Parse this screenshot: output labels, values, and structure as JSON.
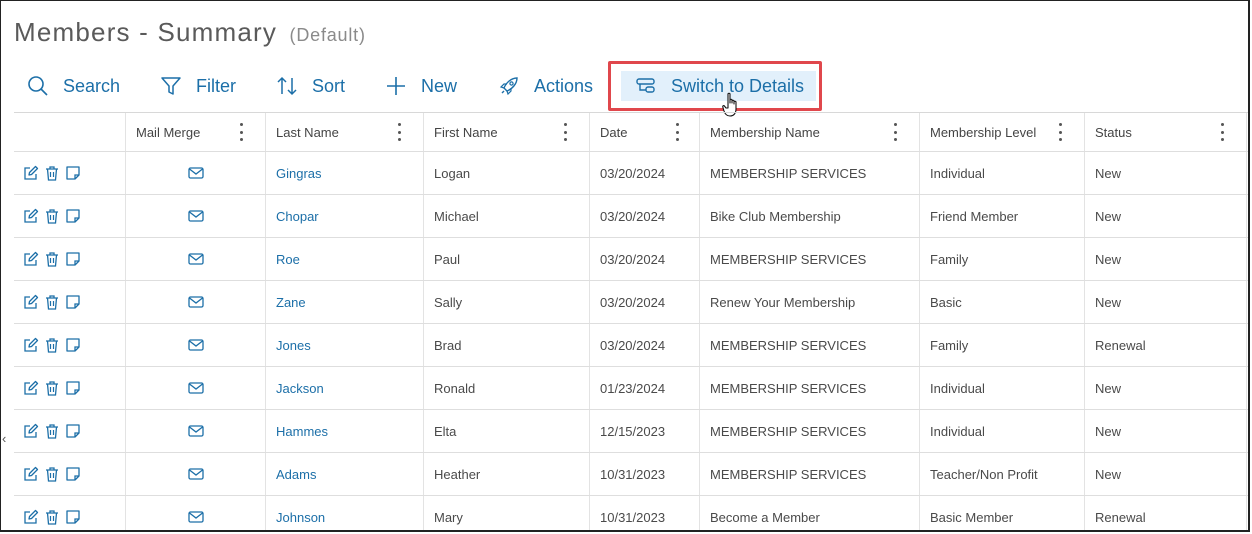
{
  "page": {
    "title": "Members - Summary",
    "view_name": "(Default)"
  },
  "toolbar": {
    "search": "Search",
    "filter": "Filter",
    "sort": "Sort",
    "new": "New",
    "actions": "Actions",
    "switch": "Switch to Details"
  },
  "columns": [
    "Mail Merge",
    "Last Name",
    "First Name",
    "Date",
    "Membership Name",
    "Membership Level",
    "Status"
  ],
  "rows": [
    {
      "last": "Gingras",
      "first": "Logan",
      "date": "03/20/2024",
      "membership": "MEMBERSHIP SERVICES",
      "level": "Individual",
      "status": "New"
    },
    {
      "last": "Chopar",
      "first": "Michael",
      "date": "03/20/2024",
      "membership": "Bike Club Membership",
      "level": "Friend Member",
      "status": "New"
    },
    {
      "last": "Roe",
      "first": "Paul",
      "date": "03/20/2024",
      "membership": "MEMBERSHIP SERVICES",
      "level": "Family",
      "status": "New"
    },
    {
      "last": "Zane",
      "first": "Sally",
      "date": "03/20/2024",
      "membership": "Renew Your Membership",
      "level": "Basic",
      "status": "New"
    },
    {
      "last": "Jones",
      "first": "Brad",
      "date": "03/20/2024",
      "membership": "MEMBERSHIP SERVICES",
      "level": "Family",
      "status": "Renewal"
    },
    {
      "last": "Jackson",
      "first": "Ronald",
      "date": "01/23/2024",
      "membership": "MEMBERSHIP SERVICES",
      "level": "Individual",
      "status": "New"
    },
    {
      "last": "Hammes",
      "first": "Elta",
      "date": "12/15/2023",
      "membership": "MEMBERSHIP SERVICES",
      "level": "Individual",
      "status": "New"
    },
    {
      "last": "Adams",
      "first": "Heather",
      "date": "10/31/2023",
      "membership": "MEMBERSHIP SERVICES",
      "level": "Teacher/Non Profit",
      "status": "New"
    },
    {
      "last": "Johnson",
      "first": "Mary",
      "date": "10/31/2023",
      "membership": "Become a Member",
      "level": "Basic Member",
      "status": "Renewal"
    }
  ],
  "colors": {
    "accent": "#1c6fa8",
    "highlight": "#e0474c",
    "switch_bg": "#e2f0fb"
  }
}
